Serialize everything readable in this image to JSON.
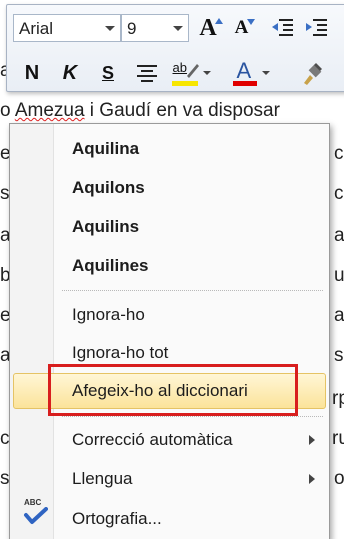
{
  "document": {
    "line_top": "a",
    "line_main_prefix": "o ",
    "line_main_underlined": "Amezua",
    "line_main_suffix": " i Gaudí en va disposar",
    "left_fragments": [
      "e",
      "s",
      "a",
      "b",
      "ei",
      "a",
      "",
      "c",
      "s"
    ],
    "right_fragments": [
      "c",
      "c",
      "a",
      "u",
      "a",
      "s",
      "rp",
      "ru",
      "o"
    ]
  },
  "toolbar": {
    "font_name": "Arial",
    "font_size": "9",
    "grow_font_label": "A",
    "shrink_font_label": "A",
    "bold_label": "N",
    "italic_label": "K",
    "underline_label": "S",
    "highlight_label": "ab",
    "font_color_label": "A",
    "colors": {
      "highlight": "#f7e600",
      "font_color": "#e00000"
    }
  },
  "context_menu": {
    "suggestions": [
      "Aquilina",
      "Aquilons",
      "Aquilins",
      "Aquilines"
    ],
    "ignore_label": "Ignora-ho",
    "ignore_all_label": "Ignora-ho tot",
    "add_to_dictionary_label": "Afegeix-ho al diccionari",
    "autocorrect_label": "Correcció automàtica",
    "language_label": "Llengua",
    "spelling_label": "Ortografia...",
    "spelling_icon_text": "ABC",
    "highlight_color": "#d81e1e"
  }
}
